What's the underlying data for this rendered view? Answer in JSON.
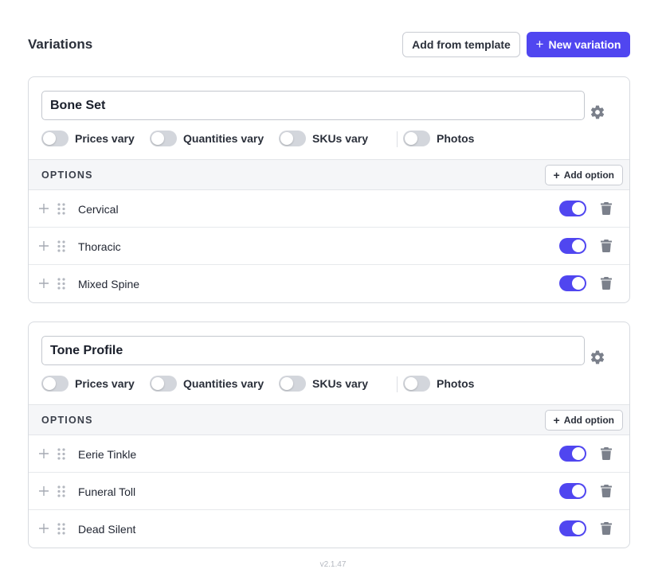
{
  "header": {
    "title": "Variations",
    "template_button": "Add from template",
    "new_button": "New variation",
    "new_button_icon": "plus-icon"
  },
  "colors": {
    "accent": "#5046f0",
    "toggle_off": "#d3d6dc",
    "icon_gray": "#7b808b"
  },
  "toggle_labels": [
    "Prices vary",
    "Quantities vary",
    "SKUs vary",
    "Photos"
  ],
  "options_header": "OPTIONS",
  "add_option_label": "Add option",
  "variations": [
    {
      "name": "Bone Set",
      "toggles": {
        "prices_vary": false,
        "quantities_vary": false,
        "skus_vary": false,
        "photos": false
      },
      "options": [
        {
          "label": "Cervical",
          "enabled": true
        },
        {
          "label": "Thoracic",
          "enabled": true
        },
        {
          "label": "Mixed Spine",
          "enabled": true
        }
      ]
    },
    {
      "name": "Tone Profile",
      "toggles": {
        "prices_vary": false,
        "quantities_vary": false,
        "skus_vary": false,
        "photos": false
      },
      "options": [
        {
          "label": "Eerie Tinkle",
          "enabled": true
        },
        {
          "label": "Funeral Toll",
          "enabled": true
        },
        {
          "label": "Dead Silent",
          "enabled": true
        }
      ]
    }
  ],
  "footer": {
    "version": "v2.1.47"
  }
}
